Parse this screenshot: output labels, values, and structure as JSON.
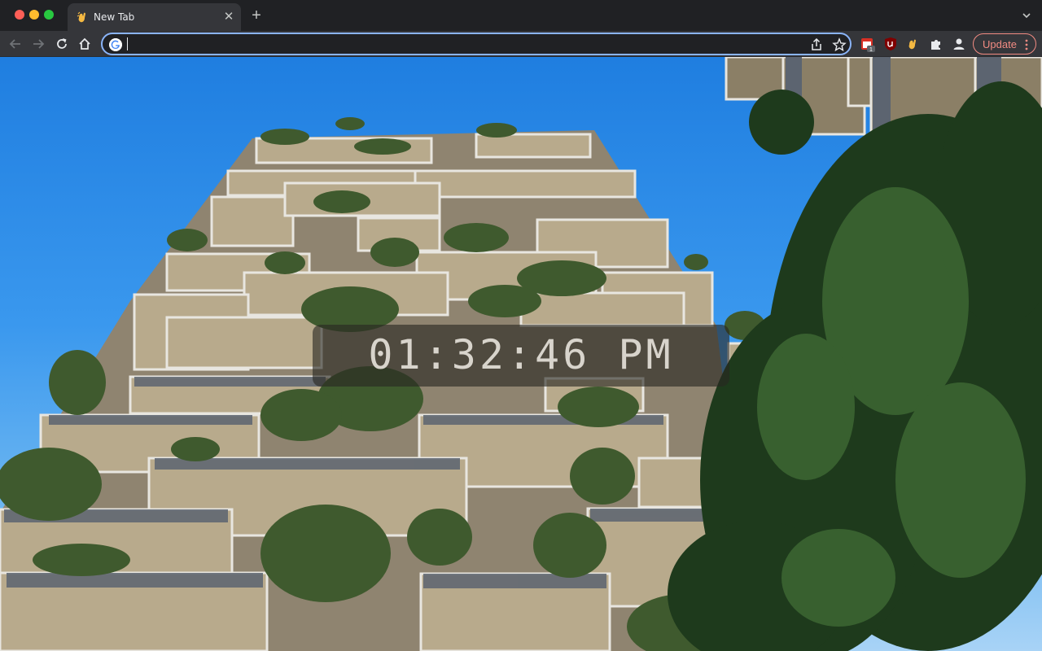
{
  "window": {
    "tab": {
      "title": "New Tab",
      "favicon": "hand-wave-icon"
    }
  },
  "toolbar": {
    "omnibox": {
      "value": "",
      "placeholder": ""
    },
    "extensions": [
      {
        "name": "calendar-extension-icon",
        "badge": "1"
      },
      {
        "name": "ublock-origin-icon"
      },
      {
        "name": "hand-wave-extension-icon"
      },
      {
        "name": "puzzle-extensions-icon"
      },
      {
        "name": "profile-avatar-icon"
      }
    ],
    "update_label": "Update"
  },
  "page": {
    "wallpaper": "vertical forest apartment towers with tree-covered balconies against a blue sky",
    "clock": "01:32:46 PM"
  },
  "colors": {
    "accent": "#8ab4f8",
    "update": "#f28b82",
    "frame": "#202124",
    "toolbar": "#35363a"
  }
}
